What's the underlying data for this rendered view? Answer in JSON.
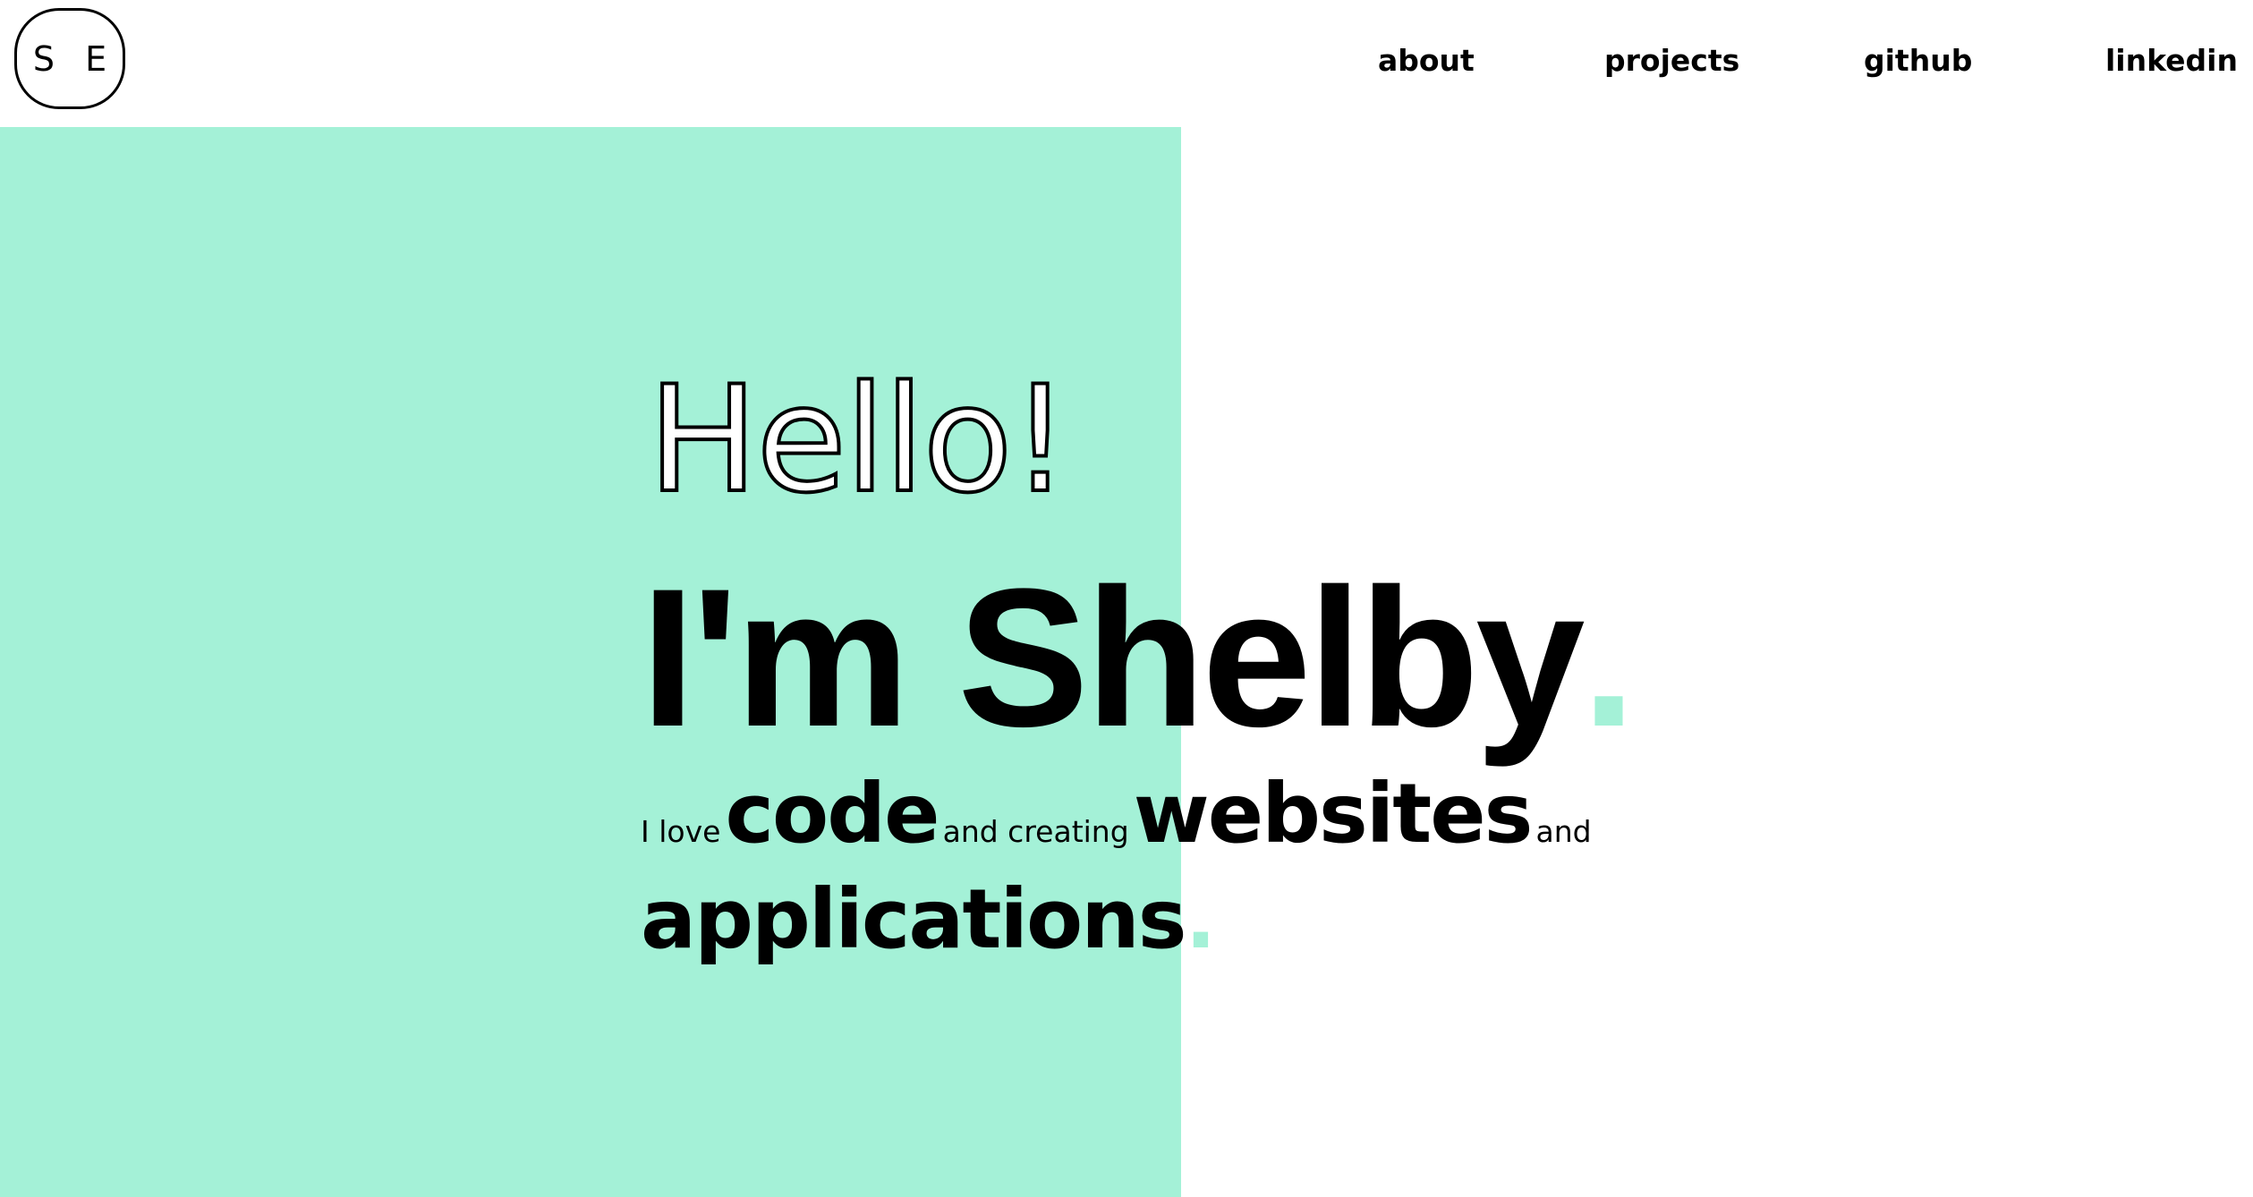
{
  "colors": {
    "accent": "#a4f1d7",
    "text": "#000000",
    "background": "#ffffff"
  },
  "header": {
    "logo_text": "S E",
    "nav": [
      {
        "label": "about"
      },
      {
        "label": "projects"
      },
      {
        "label": "github"
      },
      {
        "label": "linkedin"
      }
    ]
  },
  "hero": {
    "greeting": "Hello!",
    "name_line": "I'm Shelby",
    "name_period": ".",
    "tagline": {
      "w1": "I love",
      "w2": "code",
      "w3": "and creating",
      "w4": "websites",
      "w5": "and",
      "w6": "applications",
      "period": "."
    }
  }
}
